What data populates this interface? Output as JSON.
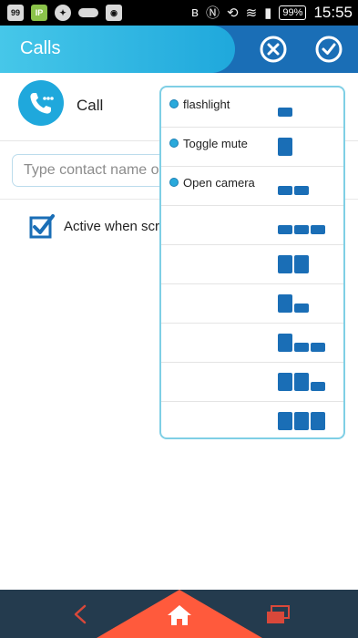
{
  "status_bar": {
    "left_icons": [
      {
        "name": "calendar-notification-icon",
        "text": "99"
      },
      {
        "name": "ip-app-icon",
        "text": "IP"
      },
      {
        "name": "accessibility-icon",
        "text": ""
      },
      {
        "name": "band-icon",
        "text": ""
      },
      {
        "name": "camera-app-icon",
        "text": ""
      }
    ],
    "battery": "99%",
    "time": "15:55"
  },
  "appbar": {
    "title": "Calls"
  },
  "call_row": {
    "label": "Call"
  },
  "search": {
    "placeholder": "Type contact name or"
  },
  "checkbox": {
    "label": "Active when scre",
    "checked": true
  },
  "popup": {
    "rows": [
      {
        "label": "flashlight",
        "blocks": [
          [
            1,
            1
          ]
        ]
      },
      {
        "label": "Toggle mute",
        "blocks": [
          [
            1,
            2
          ]
        ]
      },
      {
        "label": "Open camera",
        "blocks": [
          [
            1,
            1
          ],
          [
            1,
            1
          ]
        ]
      },
      {
        "label": "",
        "blocks": [
          [
            1,
            1
          ],
          [
            1,
            1
          ],
          [
            1,
            1
          ]
        ]
      },
      {
        "label": "",
        "blocks": [
          [
            1,
            2
          ],
          [
            1,
            2
          ]
        ]
      },
      {
        "label": "",
        "blocks": [
          [
            1,
            2
          ],
          [
            1,
            1
          ]
        ]
      },
      {
        "label": "",
        "blocks": [
          [
            1,
            2
          ],
          [
            1,
            1
          ],
          [
            1,
            1
          ]
        ]
      },
      {
        "label": "",
        "blocks": [
          [
            1,
            2
          ],
          [
            1,
            2
          ],
          [
            1,
            1
          ]
        ]
      },
      {
        "label": "",
        "blocks": [
          [
            1,
            2
          ],
          [
            1,
            2
          ],
          [
            1,
            2
          ]
        ]
      }
    ]
  },
  "colors": {
    "accent_blue": "#1a6eb6",
    "light_blue": "#1fa8dc",
    "home_orange": "#ff5a3c",
    "nav_dark": "#243b4e"
  }
}
